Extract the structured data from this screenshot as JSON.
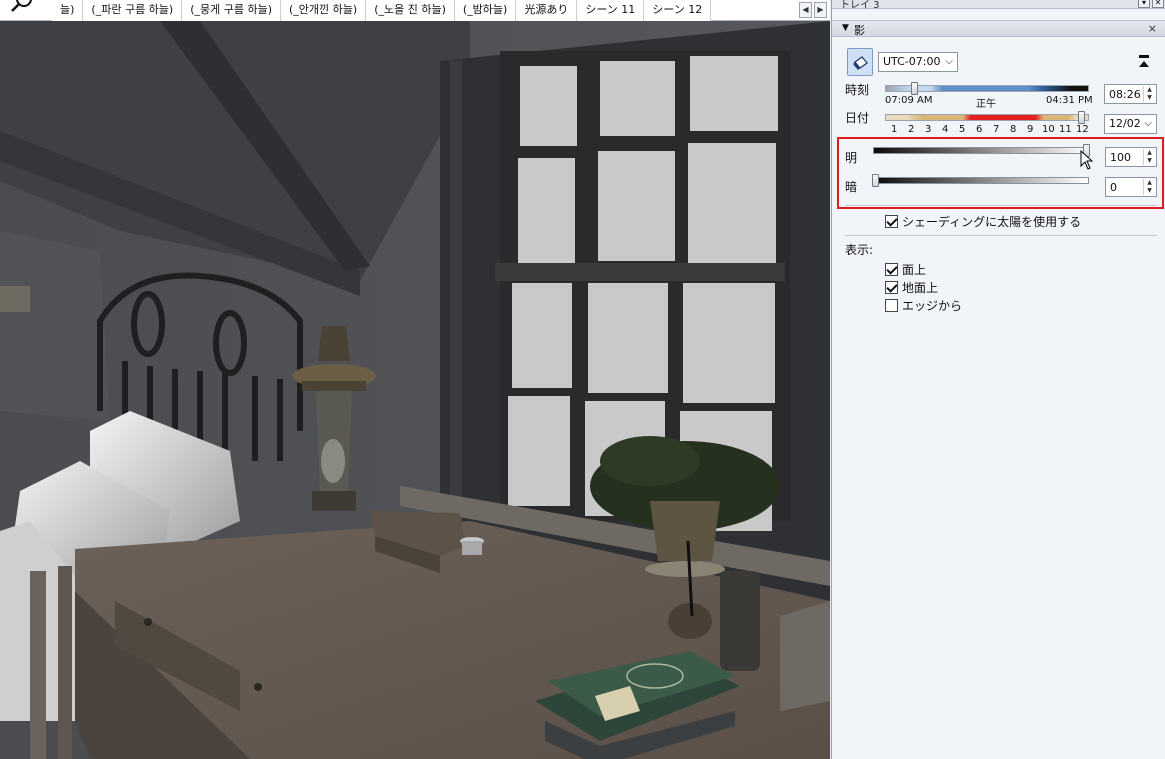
{
  "tabs": {
    "items": [
      {
        "label": "늘)"
      },
      {
        "label": "(_파란 구름 하늘)"
      },
      {
        "label": "(_뭉게 구름 하늘)"
      },
      {
        "label": "(_안개낀 하늘)"
      },
      {
        "label": "(_노을 진 하늘)"
      },
      {
        "label": "(_밤하늘)"
      },
      {
        "label": "光源あり"
      },
      {
        "label": "シーン 11"
      },
      {
        "label": "シーン 12"
      }
    ],
    "active_index": 8
  },
  "panel": {
    "tray_title": "トレイ 3",
    "section_title": "影",
    "timezone": "UTC-07:00",
    "time": {
      "label": "時刻",
      "start": "07:09 AM",
      "noon": "正午",
      "end": "04:31 PM",
      "value": "08:26",
      "position": 0.14
    },
    "date": {
      "label": "日付",
      "months": [
        "1",
        "2",
        "3",
        "4",
        "5",
        "6",
        "7",
        "8",
        "9",
        "10",
        "11",
        "12"
      ],
      "value": "12/02",
      "position": 0.96
    },
    "light": {
      "label": "明",
      "value": "100"
    },
    "dark": {
      "label": "暗",
      "value": "0"
    },
    "use_sun_shading": {
      "label": "シェーディングに太陽を使用する",
      "checked": true
    },
    "display": {
      "label": "表示:",
      "options": [
        {
          "label": "面上",
          "checked": true
        },
        {
          "label": "地面上",
          "checked": true
        },
        {
          "label": "エッジから",
          "checked": false
        }
      ]
    }
  },
  "colors": {
    "highlight": "#e01b1b",
    "panel_bg": "#f1f4f9",
    "time_bar_day": "#5e8fc8",
    "date_bar_red": "#e42020"
  }
}
